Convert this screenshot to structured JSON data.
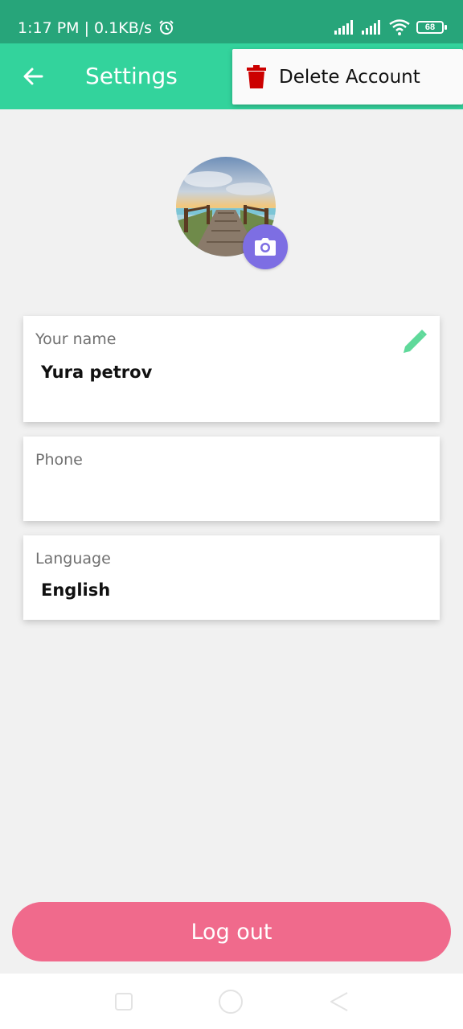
{
  "status_bar": {
    "time": "1:17 PM | 0.1KB/s",
    "battery": "68",
    "icons": [
      "alarm-icon",
      "signal-icon",
      "signal-icon",
      "wifi-icon",
      "battery-icon"
    ]
  },
  "app_bar": {
    "title": "Settings",
    "back_icon": "arrow-back-icon"
  },
  "menu": {
    "items": [
      {
        "label": "Delete Account",
        "icon": "trash-icon",
        "color": "#cc0000"
      }
    ]
  },
  "profile": {
    "avatar_icon": "avatar-photo",
    "camera_icon": "camera-icon"
  },
  "fields": {
    "name": {
      "label": "Your name",
      "value": "Yura petrov"
    },
    "phone": {
      "label": "Phone",
      "value": ""
    },
    "language": {
      "label": "Language",
      "value": "English"
    }
  },
  "logout": {
    "label": "Log out"
  },
  "colors": {
    "status_bar": "#27a57a",
    "app_bar": "#33d39c",
    "camera": "#7d6ee3",
    "logout": "#f06a8c",
    "edit": "#5fd99a"
  },
  "nav": {
    "icons": [
      "recent-apps-icon",
      "home-icon",
      "back-icon"
    ]
  }
}
